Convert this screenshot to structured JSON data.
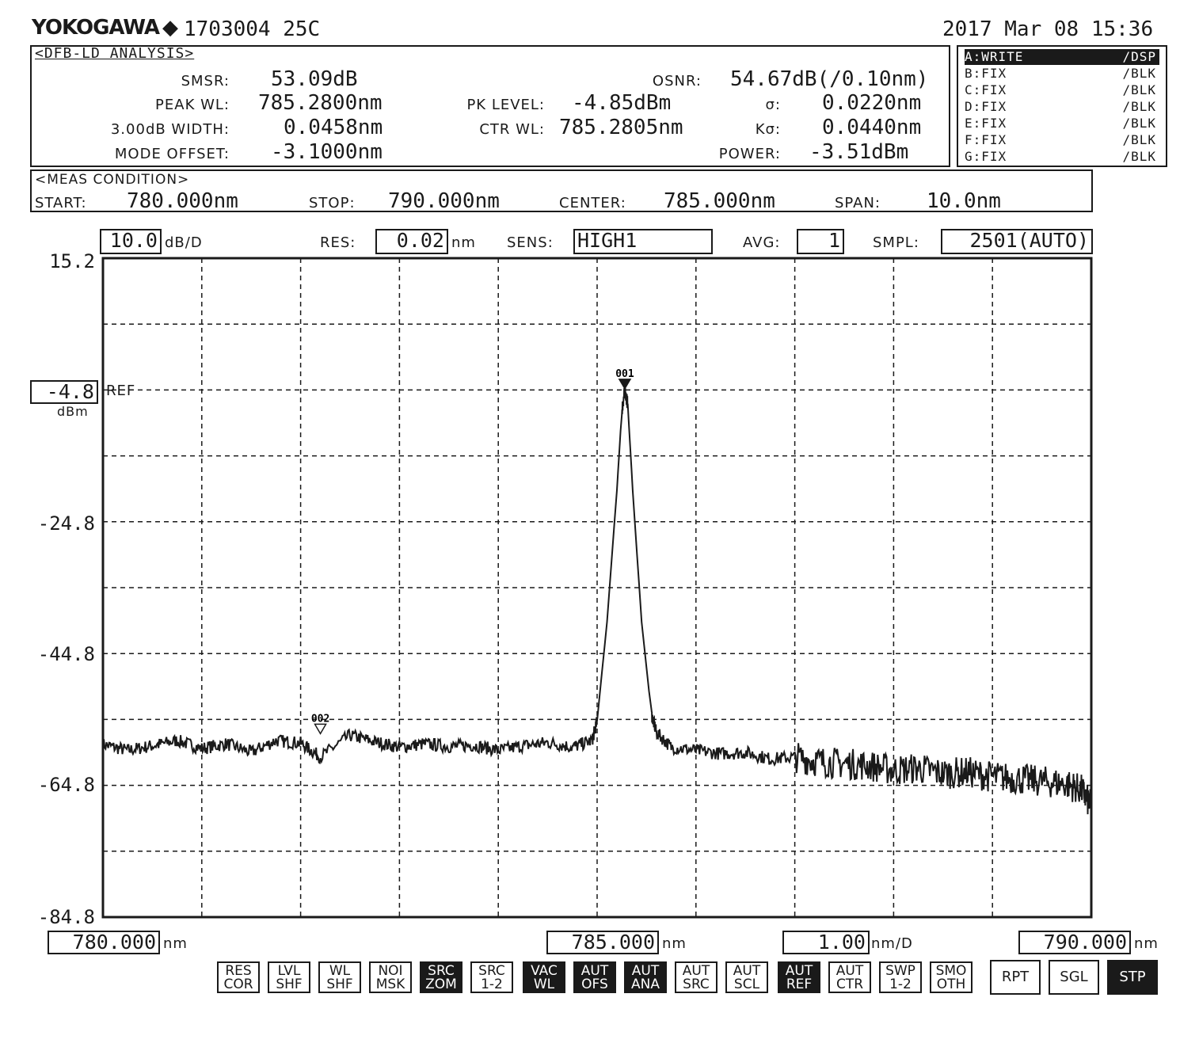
{
  "header": {
    "brand": "YOKOGAWA",
    "brand_symbol": "◆",
    "device_id": "1703004 25C",
    "datetime": "2017 Mar 08 15:36"
  },
  "analysis": {
    "title": "<DFB-LD ANALYSIS>",
    "smsr_label": "SMSR:",
    "smsr_value": "53.09dB",
    "peak_wl_label": "PEAK WL:",
    "peak_wl_value": "785.2800nm",
    "width_label": "3.00dB WIDTH:",
    "width_value": "0.0458nm",
    "mode_offset_label": "MODE OFFSET:",
    "mode_offset_value": "-3.1000nm",
    "pk_level_label": "PK LEVEL:",
    "pk_level_value": "-4.85dBm",
    "ctr_wl_label": "CTR WL:",
    "ctr_wl_value": "785.2805nm",
    "osnr_label": "OSNR:",
    "osnr_value": "54.67dB(/0.10nm)",
    "sigma_label": "σ:",
    "sigma_value": "0.0220nm",
    "ksigma_label": "Kσ:",
    "ksigma_value": "0.0440nm",
    "power_label": "POWER:",
    "power_value": "-3.51dBm"
  },
  "traces": [
    {
      "name": "A:WRITE",
      "mode": "/DSP",
      "active": true
    },
    {
      "name": "B:FIX",
      "mode": "/BLK",
      "active": false
    },
    {
      "name": "C:FIX",
      "mode": "/BLK",
      "active": false
    },
    {
      "name": "D:FIX",
      "mode": "/BLK",
      "active": false
    },
    {
      "name": "E:FIX",
      "mode": "/BLK",
      "active": false
    },
    {
      "name": "F:FIX",
      "mode": "/BLK",
      "active": false
    },
    {
      "name": "G:FIX",
      "mode": "/BLK",
      "active": false
    }
  ],
  "meas": {
    "title": "<MEAS CONDITION>",
    "start_label": "START:",
    "start_value": "780.000nm",
    "stop_label": "STOP:",
    "stop_value": "790.000nm",
    "center_label": "CENTER:",
    "center_value": "785.000nm",
    "span_label": "SPAN:",
    "span_value": "10.0nm"
  },
  "settings": {
    "scale_value": "10.0",
    "scale_unit": "dB/D",
    "res_label": "RES:",
    "res_value": "0.02",
    "res_unit": "nm",
    "sens_label": "SENS:",
    "sens_value": "HIGH1",
    "avg_label": "AVG:",
    "avg_value": "1",
    "smpl_label": "SMPL:",
    "smpl_value": "2501(AUTO)"
  },
  "ref": {
    "value": "-4.8",
    "label": "REF",
    "unit": "dBm"
  },
  "bottom": {
    "start_value": "780.000",
    "start_unit": "nm",
    "center_value": "785.000",
    "center_unit": "nm",
    "div_value": "1.00",
    "div_unit": "nm/D",
    "stop_value": "790.000",
    "stop_unit": "nm"
  },
  "softkeys": [
    {
      "label": "RES COR",
      "l1": "RES",
      "l2": "COR",
      "on": false
    },
    {
      "label": "LVL SHF",
      "l1": "LVL",
      "l2": "SHF",
      "on": false
    },
    {
      "label": "WL SHF",
      "l1": "WL",
      "l2": "SHF",
      "on": false
    },
    {
      "label": "NOI MSK",
      "l1": "NOI",
      "l2": "MSK",
      "on": false
    },
    {
      "label": "SRC ZOM",
      "l1": "SRC",
      "l2": "ZOM",
      "on": true
    },
    {
      "label": "SRC 1-2",
      "l1": "SRC",
      "l2": "1-2",
      "on": false
    },
    {
      "label": "VAC WL",
      "l1": "VAC",
      "l2": "WL",
      "on": true
    },
    {
      "label": "AUT OFS",
      "l1": "AUT",
      "l2": "OFS",
      "on": true
    },
    {
      "label": "AUT ANA",
      "l1": "AUT",
      "l2": "ANA",
      "on": true
    },
    {
      "label": "AUT SRC",
      "l1": "AUT",
      "l2": "SRC",
      "on": false
    },
    {
      "label": "AUT SCL",
      "l1": "AUT",
      "l2": "SCL",
      "on": false
    },
    {
      "label": "AUT REF",
      "l1": "AUT",
      "l2": "REF",
      "on": true
    },
    {
      "label": "AUT CTR",
      "l1": "AUT",
      "l2": "CTR",
      "on": false
    },
    {
      "label": "SWP 1-2",
      "l1": "SWP",
      "l2": "1-2",
      "on": false
    },
    {
      "label": "SMO OTH",
      "l1": "SMO",
      "l2": "OTH",
      "on": false
    }
  ],
  "sweep_buttons": [
    {
      "label": "RPT",
      "on": false
    },
    {
      "label": "SGL",
      "on": false
    },
    {
      "label": "STP",
      "on": true
    }
  ],
  "chart_data": {
    "type": "line",
    "xlim": [
      780.0,
      790.0
    ],
    "ylim": [
      -84.8,
      15.2
    ],
    "x_unit": "nm",
    "y_unit": "dBm",
    "grid": true,
    "y_ticks": [
      "15.2",
      "-24.8",
      "-44.8",
      "-64.8",
      "-84.8"
    ],
    "y_tick_values": [
      15.2,
      -24.8,
      -44.8,
      -64.8,
      -84.8
    ],
    "x_divisions": 10,
    "y_divisions": 10,
    "series": [
      {
        "x": [
          780.0,
          780.25,
          780.5,
          780.75,
          781.0,
          781.25,
          781.5,
          781.75,
          782.0,
          782.2,
          782.5,
          782.75,
          783.0,
          783.25,
          783.5,
          783.75,
          784.0,
          784.25,
          784.5,
          784.75,
          784.95,
          785.0,
          785.1,
          785.2,
          785.25,
          785.28,
          785.31,
          785.36,
          785.45,
          785.55,
          785.6,
          785.75,
          786.0,
          786.25,
          786.5,
          786.75,
          787.0,
          787.25,
          787.5,
          787.75,
          788.0,
          788.25,
          788.5,
          788.75,
          789.0,
          789.25,
          789.5,
          789.75,
          789.9,
          790.0
        ],
        "y": [
          -58.6,
          -59.5,
          -58.8,
          -58.0,
          -59.2,
          -58.5,
          -59.8,
          -58.0,
          -58.4,
          -60.5,
          -57.2,
          -58.2,
          -59.0,
          -58.5,
          -58.9,
          -58.7,
          -59.5,
          -58.8,
          -58.3,
          -59.0,
          -58.0,
          -55.0,
          -40.0,
          -20.0,
          -8.0,
          -4.85,
          -7.0,
          -20.0,
          -40.0,
          -54.0,
          -56.8,
          -59.0,
          -59.5,
          -60.0,
          -59.8,
          -60.8,
          -60.5,
          -61.2,
          -61.5,
          -61.8,
          -62.5,
          -62.2,
          -63.0,
          -62.8,
          -63.5,
          -63.8,
          -64.2,
          -64.6,
          -65.5,
          -68.0
        ]
      }
    ],
    "markers": [
      {
        "label": "001",
        "x": 785.28,
        "y": -4.85,
        "filled": true
      },
      {
        "label": "002",
        "x": 782.2,
        "y": -57.2,
        "filled": false
      }
    ]
  }
}
